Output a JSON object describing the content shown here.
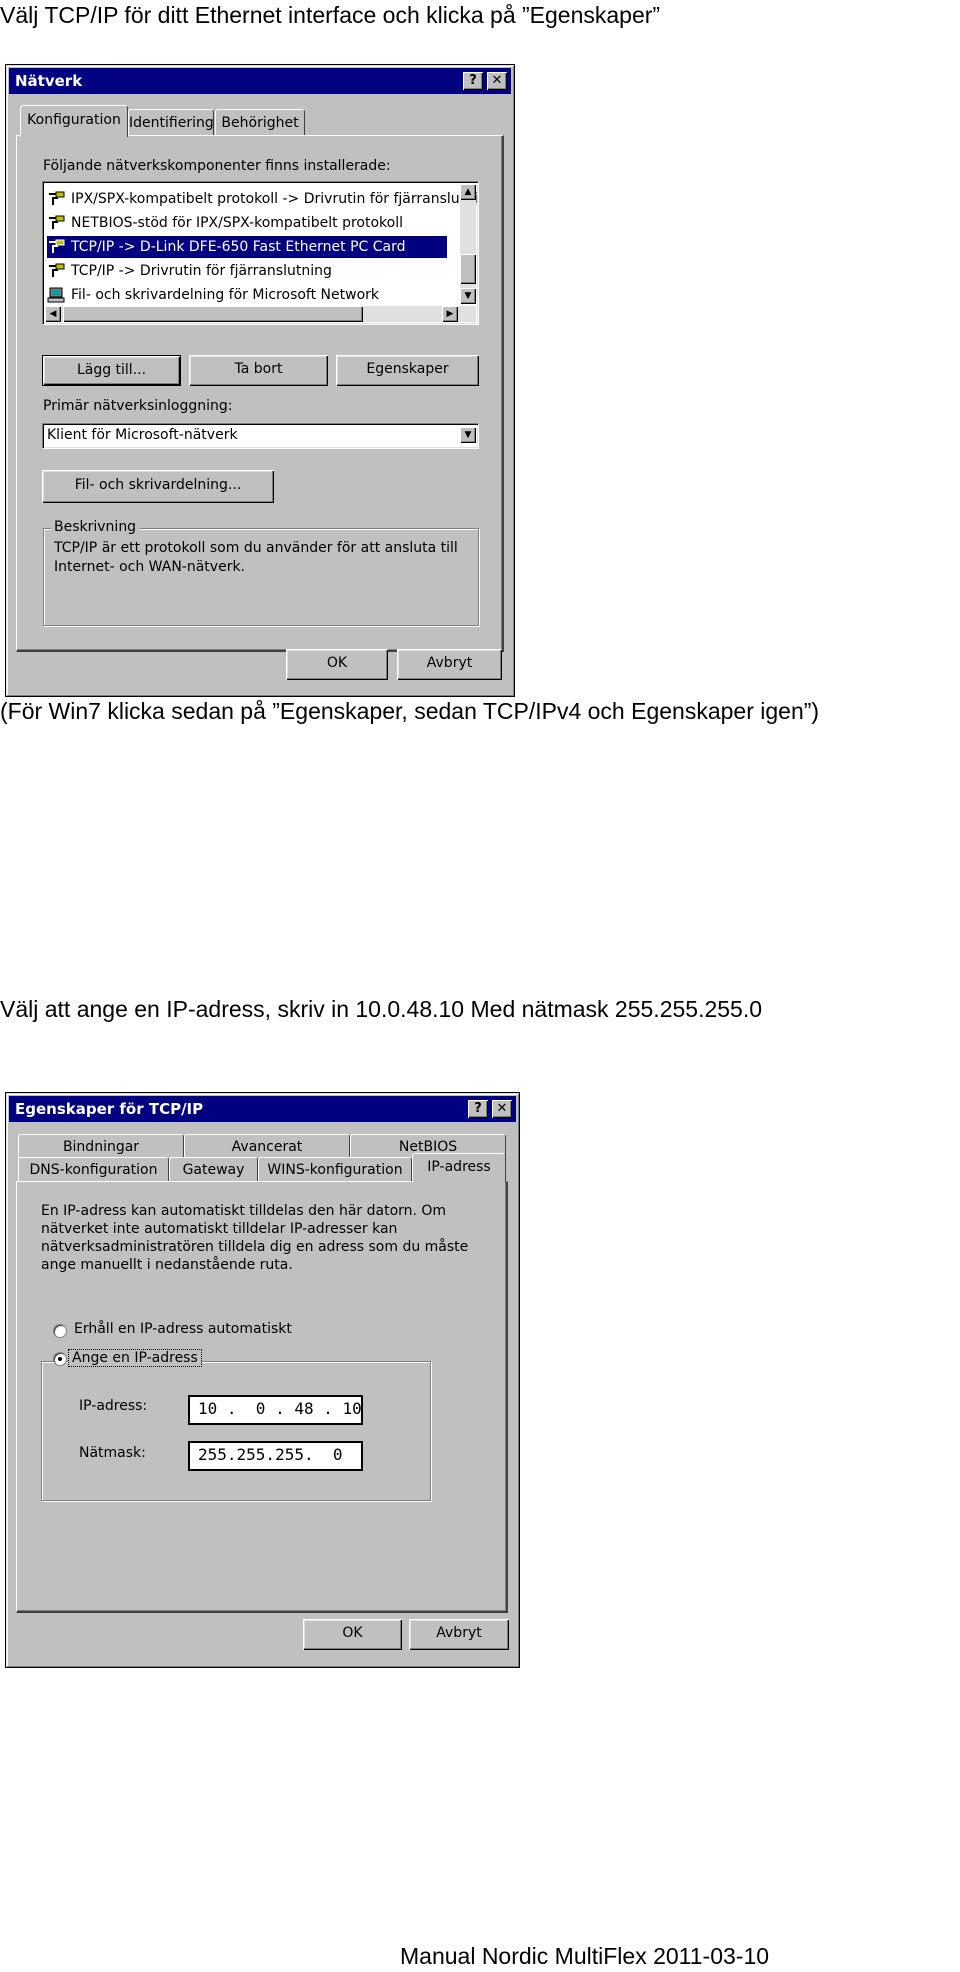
{
  "instructions": {
    "step1": "Välj TCP/IP för ditt Ethernet interface och klicka på ”Egenskaper”",
    "win7_note": "(För Win7 klicka sedan på ”Egenskaper, sedan TCP/IPv4 och Egenskaper igen”)",
    "step2": "Välj att ange en IP-adress, skriv in 10.0.48.10 Med nätmask 255.255.255.0"
  },
  "network_dialog": {
    "title": "Nätverk",
    "help_button": "?",
    "close_button": "✕",
    "tabs": [
      "Konfiguration",
      "Identifiering",
      "Behörighet"
    ],
    "components_label": "Följande nätverkskomponenter finns installerade:",
    "components": [
      "IPX/SPX-kompatibelt protokoll -> Drivrutin för fjärranslutning",
      "NETBIOS-stöd för IPX/SPX-kompatibelt protokoll",
      "TCP/IP -> D-Link DFE-650 Fast Ethernet PC Card",
      "TCP/IP -> Drivrutin för fjärranslutning",
      "Fil- och skrivardelning för Microsoft Network"
    ],
    "selected_component_index": 2,
    "add_button": "Lägg till...",
    "remove_button": "Ta bort",
    "properties_button": "Egenskaper",
    "primary_logon_label": "Primär nätverksinloggning:",
    "primary_logon_value": "Klient för Microsoft-nätverk",
    "file_sharing_button": "Fil- och skrivardelning...",
    "description_title": "Beskrivning",
    "description_text_line1": "TCP/IP är ett protokoll som du använder för att ansluta till",
    "description_text_line2": "Internet- och WAN-nätverk.",
    "ok_button": "OK",
    "cancel_button": "Avbryt"
  },
  "tcpip_dialog": {
    "title": "Egenskaper för TCP/IP",
    "help_button": "?",
    "close_button": "✕",
    "tabs_back": [
      "Bindningar",
      "Avancerat",
      "NetBIOS"
    ],
    "tabs_front": [
      "DNS-konfiguration",
      "Gateway",
      "WINS-konfiguration",
      "IP-adress"
    ],
    "info_line1": "En IP-adress kan automatiskt tilldelas den här datorn. Om",
    "info_line2": "nätverket inte automatiskt tilldelar IP-adresser kan",
    "info_line3": "nätverksadministratören tilldela dig en adress som du måste",
    "info_line4": "ange manuellt i nedanstående ruta.",
    "radio_auto": "Erhåll en IP-adress automatiskt",
    "radio_manual": "Ange en IP-adress",
    "ip_label": "IP-adress:",
    "ip_value": "10 .  0 . 48 . 10",
    "mask_label": "Nätmask:",
    "mask_value": "255.255.255.  0",
    "ok_button": "OK",
    "cancel_button": "Avbryt"
  },
  "footer": "Manual Nordic MultiFlex 2011-03-10"
}
